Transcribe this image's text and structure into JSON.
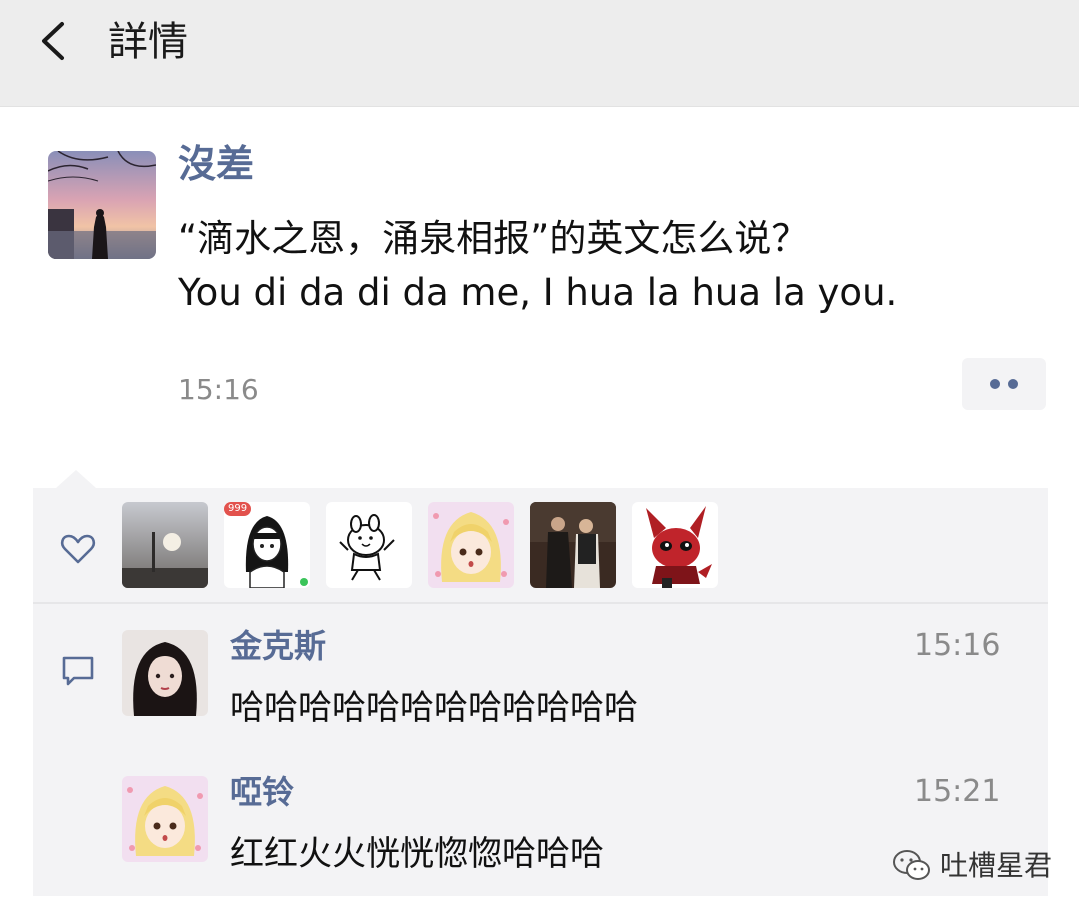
{
  "header": {
    "title": "詳情",
    "back_icon": "chevron-left-icon"
  },
  "post": {
    "author": "沒差",
    "lines": [
      "“滴水之恩，涌泉相报”的英文怎么说？",
      "You di da di da me, I hua la hua la you."
    ],
    "time": "15:16",
    "more_icon": "more-dots-icon"
  },
  "likes": {
    "icon": "heart-outline-icon",
    "badge": "999"
  },
  "comments": {
    "icon": "comment-bubble-icon",
    "items": [
      {
        "name": "金克斯",
        "time": "15:16",
        "text": "哈哈哈哈哈哈哈哈哈哈哈哈"
      },
      {
        "name": "啞铃",
        "time": "15:21",
        "text": "红红火火恍恍惚惚哈哈哈"
      }
    ]
  },
  "watermark": {
    "text": "吐槽星君"
  },
  "colors": {
    "link_blue": "#576b95",
    "header_bg": "#ededed",
    "panel_bg": "#f3f3f5"
  }
}
